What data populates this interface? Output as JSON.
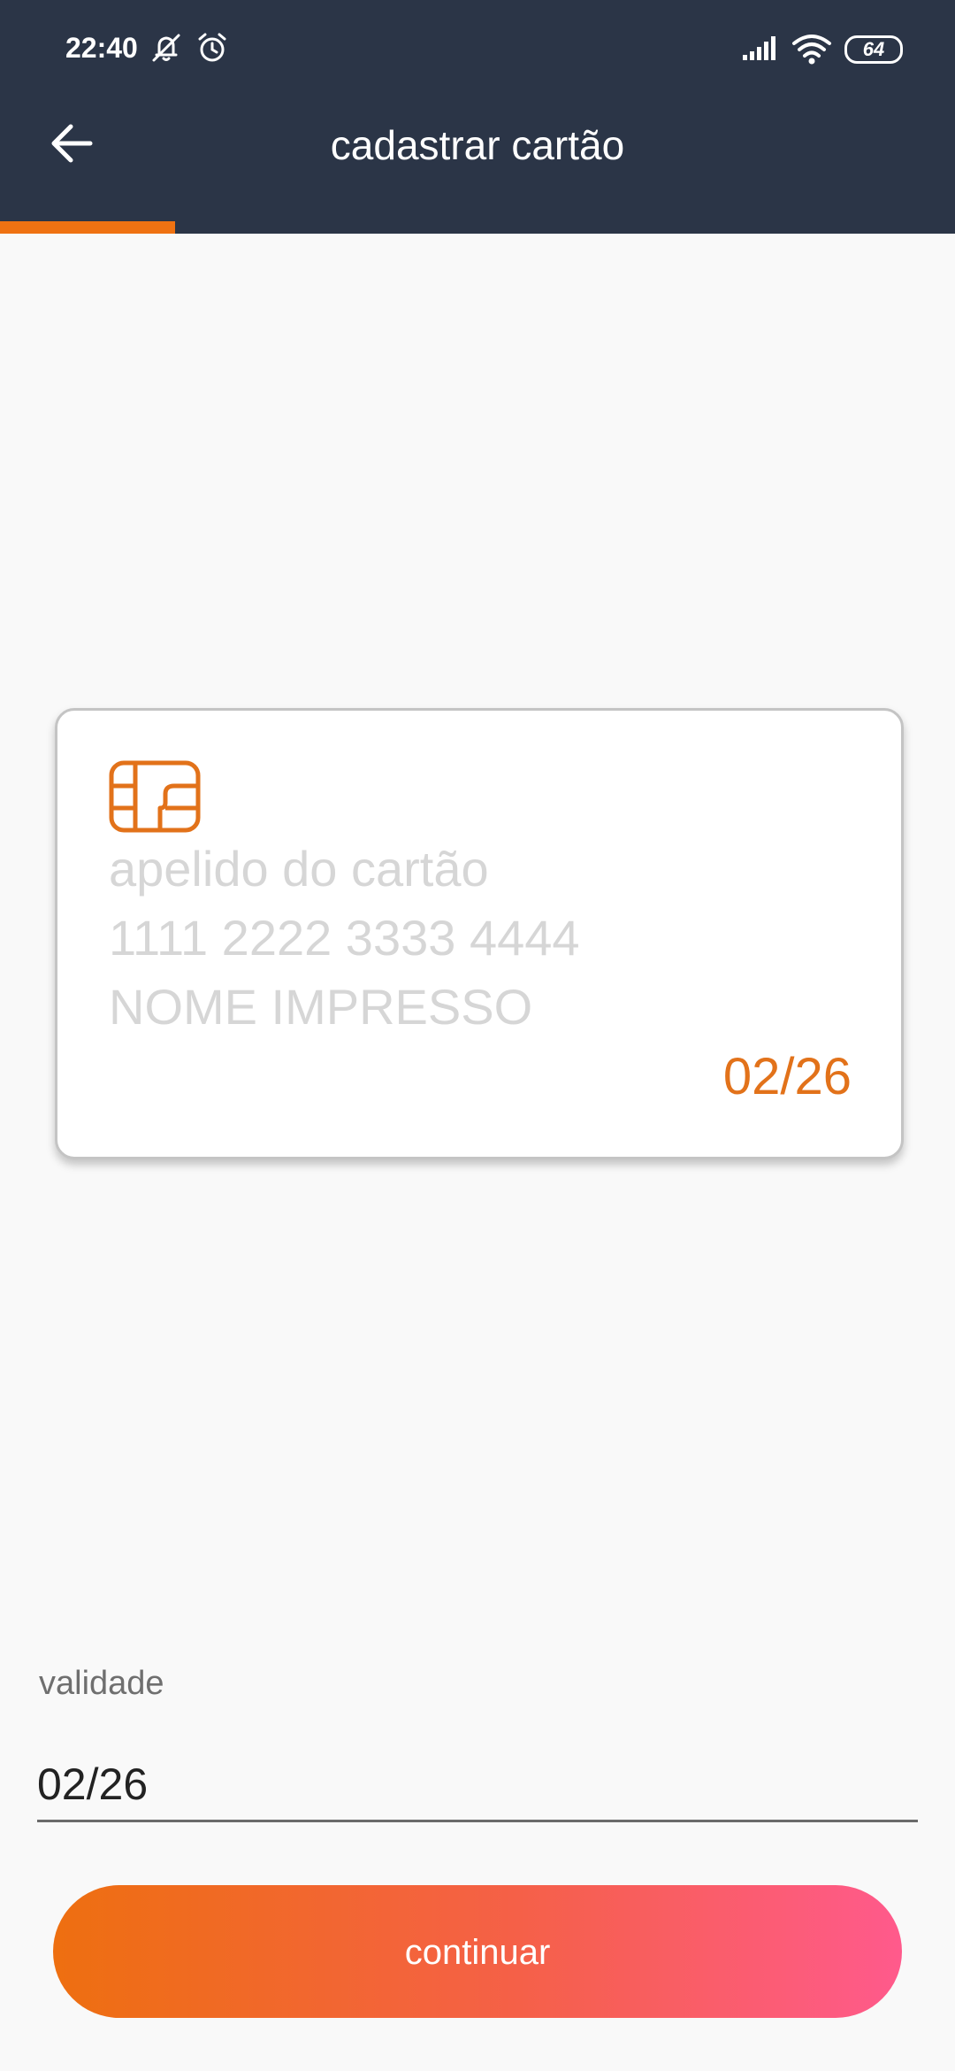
{
  "status_bar": {
    "time": "22:40",
    "battery": "64",
    "icons": [
      "notifications-muted-icon",
      "alarm-icon",
      "signal-icon",
      "wifi-icon",
      "battery-icon"
    ]
  },
  "app_bar": {
    "title": "cadastrar cartão",
    "back_icon": "arrow-left-icon"
  },
  "progress": {
    "fraction": 0.183
  },
  "card_preview": {
    "chip_icon": "card-chip-icon",
    "nickname_placeholder": "apelido do cartão",
    "number_placeholder": "1111 2222 3333 4444",
    "name_placeholder": "NOME IMPRESSO",
    "expiry": "02/26"
  },
  "form": {
    "expiry_label": "validade",
    "expiry_value": "02/26"
  },
  "actions": {
    "continue_label": "continuar"
  },
  "colors": {
    "header_bg": "#2b3547",
    "accent": "#ef7212",
    "button_gradient_start": "#ee6f10",
    "button_gradient_end": "#ff5a8c",
    "placeholder_text": "#d6d6d6",
    "background": "#f9f9f9"
  }
}
